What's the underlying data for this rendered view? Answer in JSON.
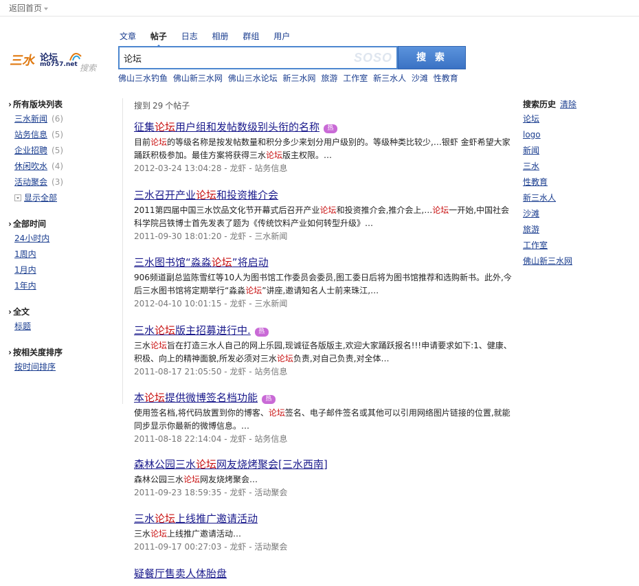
{
  "topbar": {
    "home_label": "返回首页"
  },
  "logo": {
    "mark": "三水",
    "title": "论坛",
    "domain": "m0757.net",
    "sub": "搜索"
  },
  "tabs": [
    {
      "label": "文章",
      "active": false
    },
    {
      "label": "帖子",
      "active": true
    },
    {
      "label": "日志",
      "active": false
    },
    {
      "label": "相册",
      "active": false
    },
    {
      "label": "群组",
      "active": false
    },
    {
      "label": "用户",
      "active": false
    }
  ],
  "search": {
    "value": "论坛",
    "watermark": "SOSO",
    "button_label": "搜 索"
  },
  "hotwords": [
    "佛山三水钓鱼",
    "佛山新三水网",
    "佛山三水论坛",
    "新三水网",
    "旅游",
    "工作室",
    "新三水人",
    "沙滩",
    "性教育"
  ],
  "left": {
    "forums_heading": "所有版块列表",
    "forums": [
      {
        "label": "三水新闻",
        "count": "(6)"
      },
      {
        "label": "站务信息",
        "count": "(5)"
      },
      {
        "label": "企业招聘",
        "count": "(5)"
      },
      {
        "label": "休闲吹水",
        "count": "(4)"
      },
      {
        "label": "活动聚会",
        "count": "(3)"
      }
    ],
    "show_all": "显示全部",
    "time_heading": "全部时间",
    "times": [
      "24小时内",
      "1周内",
      "1月内",
      "1年内"
    ],
    "scope_heading": "全文",
    "scopes": [
      "标题"
    ],
    "sort_heading": "按相关度排序",
    "sorts": [
      "按时间排序"
    ]
  },
  "results": {
    "count_prefix": "搜到",
    "count": "29",
    "count_suffix": "个帖子",
    "items": [
      {
        "title": [
          "征集",
          "论坛",
          "用户组和发帖数级别头衔的名称"
        ],
        "hot": true,
        "snippet": [
          "目前",
          "论坛",
          "的等级名称是按发帖数量和积分多少来划分用户级别的。等级种类比较少,…银虾  金虾希望大家踊跃积极参加。最佳方案将获得三水",
          "论坛",
          "版主权限。…"
        ],
        "meta": "2012-03-24 13:04:28 - 龙虾 - 站务信息"
      },
      {
        "title": [
          "三水召开产业",
          "论坛",
          "和投资推介会"
        ],
        "hot": false,
        "snippet": [
          "2011第四届中国三水饮品文化节开幕式后召开产业",
          "论坛",
          "和投资推介会,推介会上,…",
          "论坛",
          "一开始,中国社会科学院吕铁博士首先发表了题为《传统饮料产业如何转型升级》…"
        ],
        "meta": "2011-09-30 18:01:20 - 龙虾 - 三水新闻"
      },
      {
        "title": [
          "三水图书馆“淼淼",
          "论坛",
          "”将启动"
        ],
        "hot": false,
        "snippet": [
          "906频道副总监陈雪红等10人为图书馆工作委员会委员,图工委日后将为图书馆推荐和选购新书。此外,今后三水图书馆将定期举行“淼淼",
          "论坛",
          "”讲座,邀请知名人士前来珠江,…"
        ],
        "meta": "2012-04-10 10:01:15 - 龙虾 - 三水新闻"
      },
      {
        "title": [
          "三水",
          "论坛",
          "版主招募进行中."
        ],
        "hot": true,
        "snippet": [
          "三水",
          "论坛",
          "旨在打造三水人自己的网上乐园,现诚征各版版主,欢迎大家踊跃报名!!!申请要求如下:1、健康、积极、向上的精神面貌,所发必须对三水",
          "论坛",
          "负责,对自己负责,对全体…"
        ],
        "meta": "2011-08-17 21:05:50 - 龙虾 - 站务信息"
      },
      {
        "title": [
          "本",
          "论坛",
          "提供微博签名档功能"
        ],
        "hot": true,
        "snippet": [
          "使用签名档,将代码放置到你的博客、",
          "论坛",
          "签名、电子邮件签名或其他可以引用网络图片链接的位置,就能同步显示你最新的微博信息。…"
        ],
        "meta": "2011-08-18 22:14:04 - 龙虾 - 站务信息"
      },
      {
        "title": [
          "森林公园三水",
          "论坛",
          "网友烧烤聚会[三水西南]"
        ],
        "hot": false,
        "snippet": [
          "森林公园三水",
          "论坛",
          "网友烧烤聚会…"
        ],
        "meta": "2011-09-23 18:59:35 - 龙虾 - 活动聚会"
      },
      {
        "title": [
          "三水",
          "论坛",
          "上线推广邀请活动"
        ],
        "hot": false,
        "snippet": [
          "三水",
          "论坛",
          "上线推广邀请活动…"
        ],
        "meta": "2011-09-17 00:27:03 - 龙虾 - 活动聚会"
      },
      {
        "title": [
          "疑餐厅售卖人体胎盘"
        ],
        "hot": false,
        "snippet": [],
        "meta": ""
      }
    ],
    "hot_badge": "热"
  },
  "right": {
    "heading": "搜索历史",
    "clear_label": "清除",
    "history": [
      "论坛",
      "logo",
      "新闻",
      "三水",
      "性教育",
      "新三水人",
      "沙滩",
      "旅游",
      "工作室",
      "佛山新三水网"
    ]
  }
}
